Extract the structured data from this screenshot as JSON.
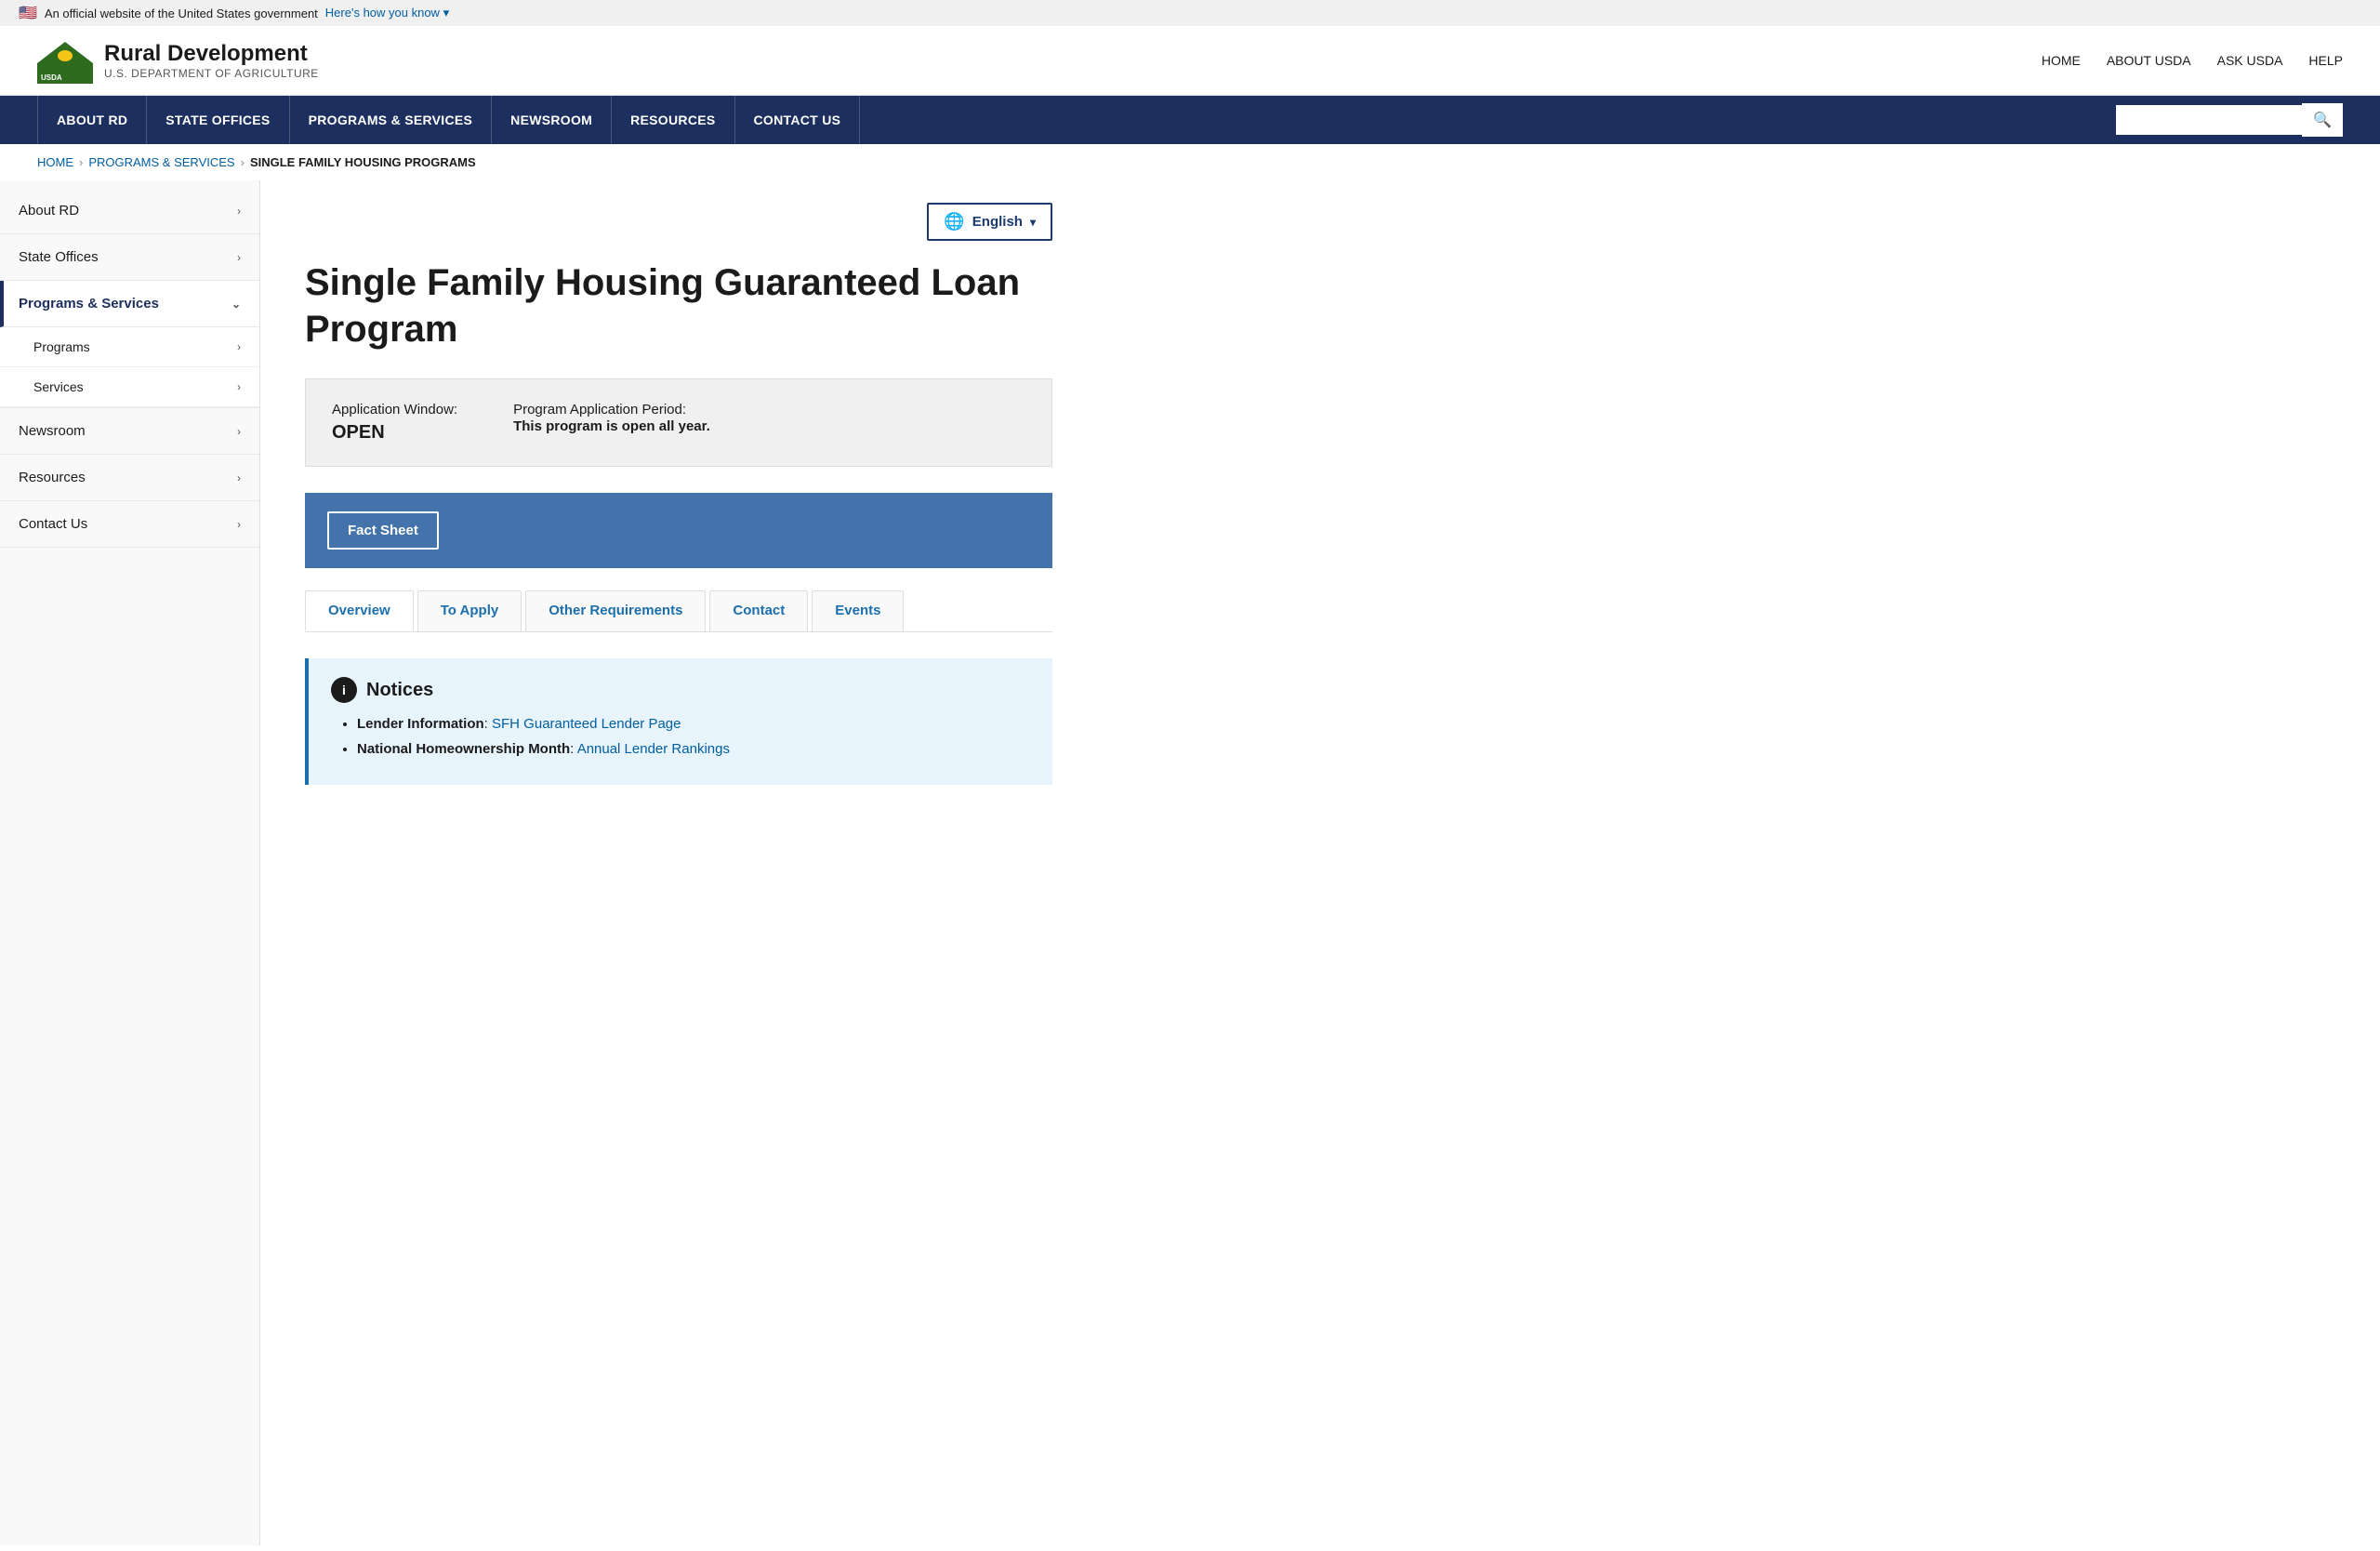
{
  "gov_banner": {
    "flag": "🇺🇸",
    "text": "An official website of the United States government",
    "link_text": "Here's how you know",
    "link_caret": "▾"
  },
  "header": {
    "logo_abbr": "USDA",
    "title": "Rural Development",
    "subtitle": "U.S. DEPARTMENT OF AGRICULTURE",
    "top_nav": [
      {
        "label": "HOME",
        "href": "#"
      },
      {
        "label": "ABOUT USDA",
        "href": "#"
      },
      {
        "label": "ASK USDA",
        "href": "#"
      },
      {
        "label": "HELP",
        "href": "#"
      }
    ]
  },
  "main_nav": [
    {
      "label": "ABOUT RD",
      "href": "#"
    },
    {
      "label": "STATE OFFICES",
      "href": "#"
    },
    {
      "label": "PROGRAMS & SERVICES",
      "href": "#"
    },
    {
      "label": "NEWSROOM",
      "href": "#"
    },
    {
      "label": "RESOURCES",
      "href": "#"
    },
    {
      "label": "CONTACT US",
      "href": "#"
    }
  ],
  "search": {
    "placeholder": "",
    "button_icon": "🔍"
  },
  "breadcrumb": [
    {
      "label": "HOME",
      "href": "#"
    },
    {
      "label": "PROGRAMS & SERVICES",
      "href": "#"
    },
    {
      "label": "SINGLE FAMILY HOUSING PROGRAMS",
      "current": true
    }
  ],
  "sidebar": {
    "items": [
      {
        "label": "About RD",
        "active": false,
        "expanded": false
      },
      {
        "label": "State Offices",
        "active": false,
        "expanded": false
      },
      {
        "label": "Programs & Services",
        "active": true,
        "expanded": true
      },
      {
        "label": "Programs",
        "sub": true
      },
      {
        "label": "Services",
        "sub": true
      },
      {
        "label": "Newsroom",
        "active": false,
        "expanded": false
      },
      {
        "label": "Resources",
        "active": false,
        "expanded": false
      },
      {
        "label": "Contact Us",
        "active": false,
        "expanded": false
      }
    ]
  },
  "language": {
    "label": "English",
    "globe_icon": "🌐",
    "caret": "▾"
  },
  "page": {
    "title": "Single Family Housing Guaranteed Loan Program",
    "app_window": {
      "window_label": "Application Window:",
      "status": "OPEN",
      "period_label": "Program Application Period:",
      "period_desc": "This program is open all year."
    },
    "fact_sheet": {
      "button_label": "Fact Sheet"
    },
    "tabs": [
      {
        "label": "Overview",
        "active": true
      },
      {
        "label": "To Apply",
        "active": false
      },
      {
        "label": "Other Requirements",
        "active": false
      },
      {
        "label": "Contact",
        "active": false
      },
      {
        "label": "Events",
        "active": false
      }
    ],
    "notices": {
      "heading": "Notices",
      "items": [
        {
          "prefix": "Lender Information",
          "link_text": "SFH Guaranteed Lender Page",
          "link_href": "#"
        },
        {
          "prefix": "National Homeownership Month",
          "link_text": "Annual Lender Rankings",
          "link_href": "#"
        }
      ]
    }
  }
}
